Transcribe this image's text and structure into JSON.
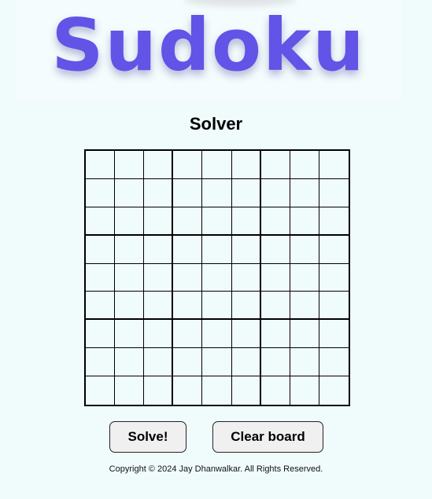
{
  "header": {
    "logo_text": "Sudoku",
    "subtitle": "Solver"
  },
  "board": {
    "size": 9,
    "cells": [
      [
        "",
        "",
        "",
        "",
        "",
        "",
        "",
        "",
        ""
      ],
      [
        "",
        "",
        "",
        "",
        "",
        "",
        "",
        "",
        ""
      ],
      [
        "",
        "",
        "",
        "",
        "",
        "",
        "",
        "",
        ""
      ],
      [
        "",
        "",
        "",
        "",
        "",
        "",
        "",
        "",
        ""
      ],
      [
        "",
        "",
        "",
        "",
        "",
        "",
        "",
        "",
        ""
      ],
      [
        "",
        "",
        "",
        "",
        "",
        "",
        "",
        "",
        ""
      ],
      [
        "",
        "",
        "",
        "",
        "",
        "",
        "",
        "",
        ""
      ],
      [
        "",
        "",
        "",
        "",
        "",
        "",
        "",
        "",
        ""
      ],
      [
        "",
        "",
        "",
        "",
        "",
        "",
        "",
        "",
        ""
      ]
    ]
  },
  "buttons": {
    "solve_label": "Solve!",
    "clear_label": "Clear board"
  },
  "footer": {
    "copyright": "Copyright © 2024 Jay Dhanwalkar. All Rights Reserved."
  },
  "colors": {
    "logo": "#6154e6",
    "background": "#f0fbfc",
    "button_bg": "#f0f0f0"
  }
}
